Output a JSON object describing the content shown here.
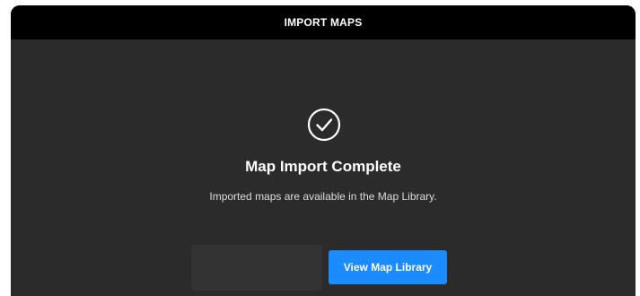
{
  "dialog": {
    "header_title": "IMPORT MAPS",
    "status_icon": "check-circle-icon",
    "title": "Map Import Complete",
    "message": "Imported maps are available in the Map Library.",
    "primary_button_label": "View Map Library",
    "secondary_button_label": ""
  },
  "colors": {
    "header_bg": "#000000",
    "panel_bg": "#2b2b2b",
    "primary_button_bg": "#1a8cff",
    "text": "#ffffff"
  }
}
